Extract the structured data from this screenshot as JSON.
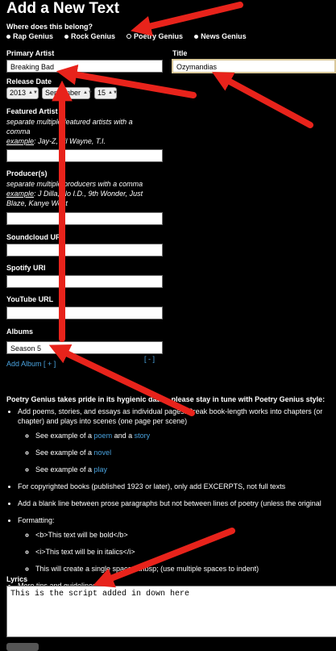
{
  "page": {
    "title": "Add a New Text",
    "belong_question": "Where does this belong?",
    "genres": [
      {
        "label": "Rap Genius",
        "selected": true
      },
      {
        "label": "Rock Genius",
        "selected": true
      },
      {
        "label": "Poetry Genius",
        "selected": false
      },
      {
        "label": "News Genius",
        "selected": true
      }
    ]
  },
  "form": {
    "primary_artist_label": "Primary Artist",
    "primary_artist_value": "Breaking Bad",
    "title_label": "Title",
    "title_value": "Ozymandias",
    "release_date_label": "Release Date",
    "release_year": "2013",
    "release_month": "September",
    "release_day": "15",
    "featured_label": "Featured Artist",
    "featured_hint": "separate multiple featured artists with a comma",
    "featured_example_prefix": "example",
    "featured_example": ": Jay-Z, Lil Wayne, T.I.",
    "producer_label": "Producer(s)",
    "producer_hint": "separate multiple producers with a comma",
    "producer_example_prefix": "example",
    "producer_example": ": J Dilla, No I.D., 9th Wonder, Just Blaze, Kanye West",
    "soundcloud_label": "Soundcloud URL",
    "spotify_label": "Spotify URI",
    "youtube_label": "YouTube URL",
    "albums_label": "Albums",
    "album_value": "Season 5",
    "remove_album": "[ - ]",
    "add_album": "Add Album [ + ]"
  },
  "guidelines": {
    "heading": "Poetry Genius takes pride in its hygienic data – please stay in tune with Poetry Genius style:",
    "item1": "Add poems, stories, and essays as individual pages. Break book-length works into chapters (or chapter) and plays into scenes (one page per scene)",
    "item1_line1": "Add poems, stories, and essays as individual pages. Break book-length works into chapters (or",
    "item1_line2": "chapter) and plays into scenes (one page per scene)",
    "see_prefix": "See example of a ",
    "poem": "poem",
    "and": " and a ",
    "story": "story",
    "novel": "novel",
    "play": "play",
    "item2": "For copyrighted books (published 1923 or later), only add EXCERPTS, not full texts",
    "item3": "Add a blank line between prose paragraphs but not between lines of poetry (unless the original",
    "item4": "Formatting:",
    "fmt1": "<b>This text will be bold</b>",
    "fmt2": "<i>This text will be in italics</i>",
    "fmt3": "This will create a single space: &nbsp; (use multiple spaces to indent)",
    "item5_prefix": "More tips and guidelines ",
    "item5_link": "here"
  },
  "lyrics": {
    "label": "Lyrics",
    "value": "This is the script added in down here"
  },
  "colors": {
    "background": "#000000",
    "link": "#4aa3df",
    "arrow": "#e8231b"
  }
}
